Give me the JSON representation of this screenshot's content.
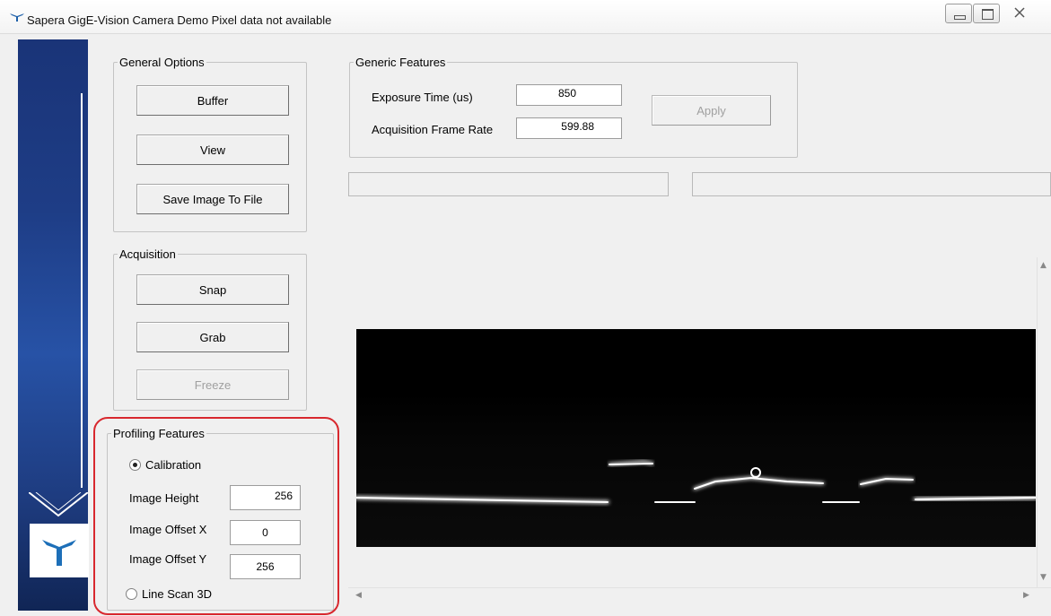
{
  "window": {
    "title": "Sapera GigE-Vision Camera Demo  Pixel data not available",
    "app_icon": "teledyne-icon",
    "caption_buttons": [
      "minimize-icon",
      "maximize-icon",
      "close-icon"
    ]
  },
  "general_options": {
    "legend": "General Options",
    "buffer_label": "Buffer",
    "view_label": "View",
    "save_label": "Save Image To File"
  },
  "acquisition": {
    "legend": "Acquisition",
    "snap_label": "Snap",
    "grab_label": "Grab",
    "freeze_label": "Freeze"
  },
  "profiling": {
    "legend": "Profiling Features",
    "calibration_label": "Calibration",
    "calibration_selected": true,
    "image_height_label": "Image Height",
    "image_height_value": "256",
    "offset_x_label": "Image Offset X",
    "offset_x_value": "0",
    "offset_y_label": "Image Offset Y",
    "offset_y_value": "256",
    "line_scan_label": "Line Scan 3D",
    "line_scan_selected": false
  },
  "generic_features": {
    "legend": "Generic Features",
    "exposure_label": "Exposure Time (us)",
    "exposure_value": "850",
    "frame_rate_label": "Acquisition Frame Rate",
    "frame_rate_value": "599.88",
    "apply_label": "Apply"
  },
  "colors": {
    "side_panel": "#1e3d86",
    "highlight": "#d8282e",
    "laser_line": "#ffffff",
    "image_bg": "#000000"
  }
}
